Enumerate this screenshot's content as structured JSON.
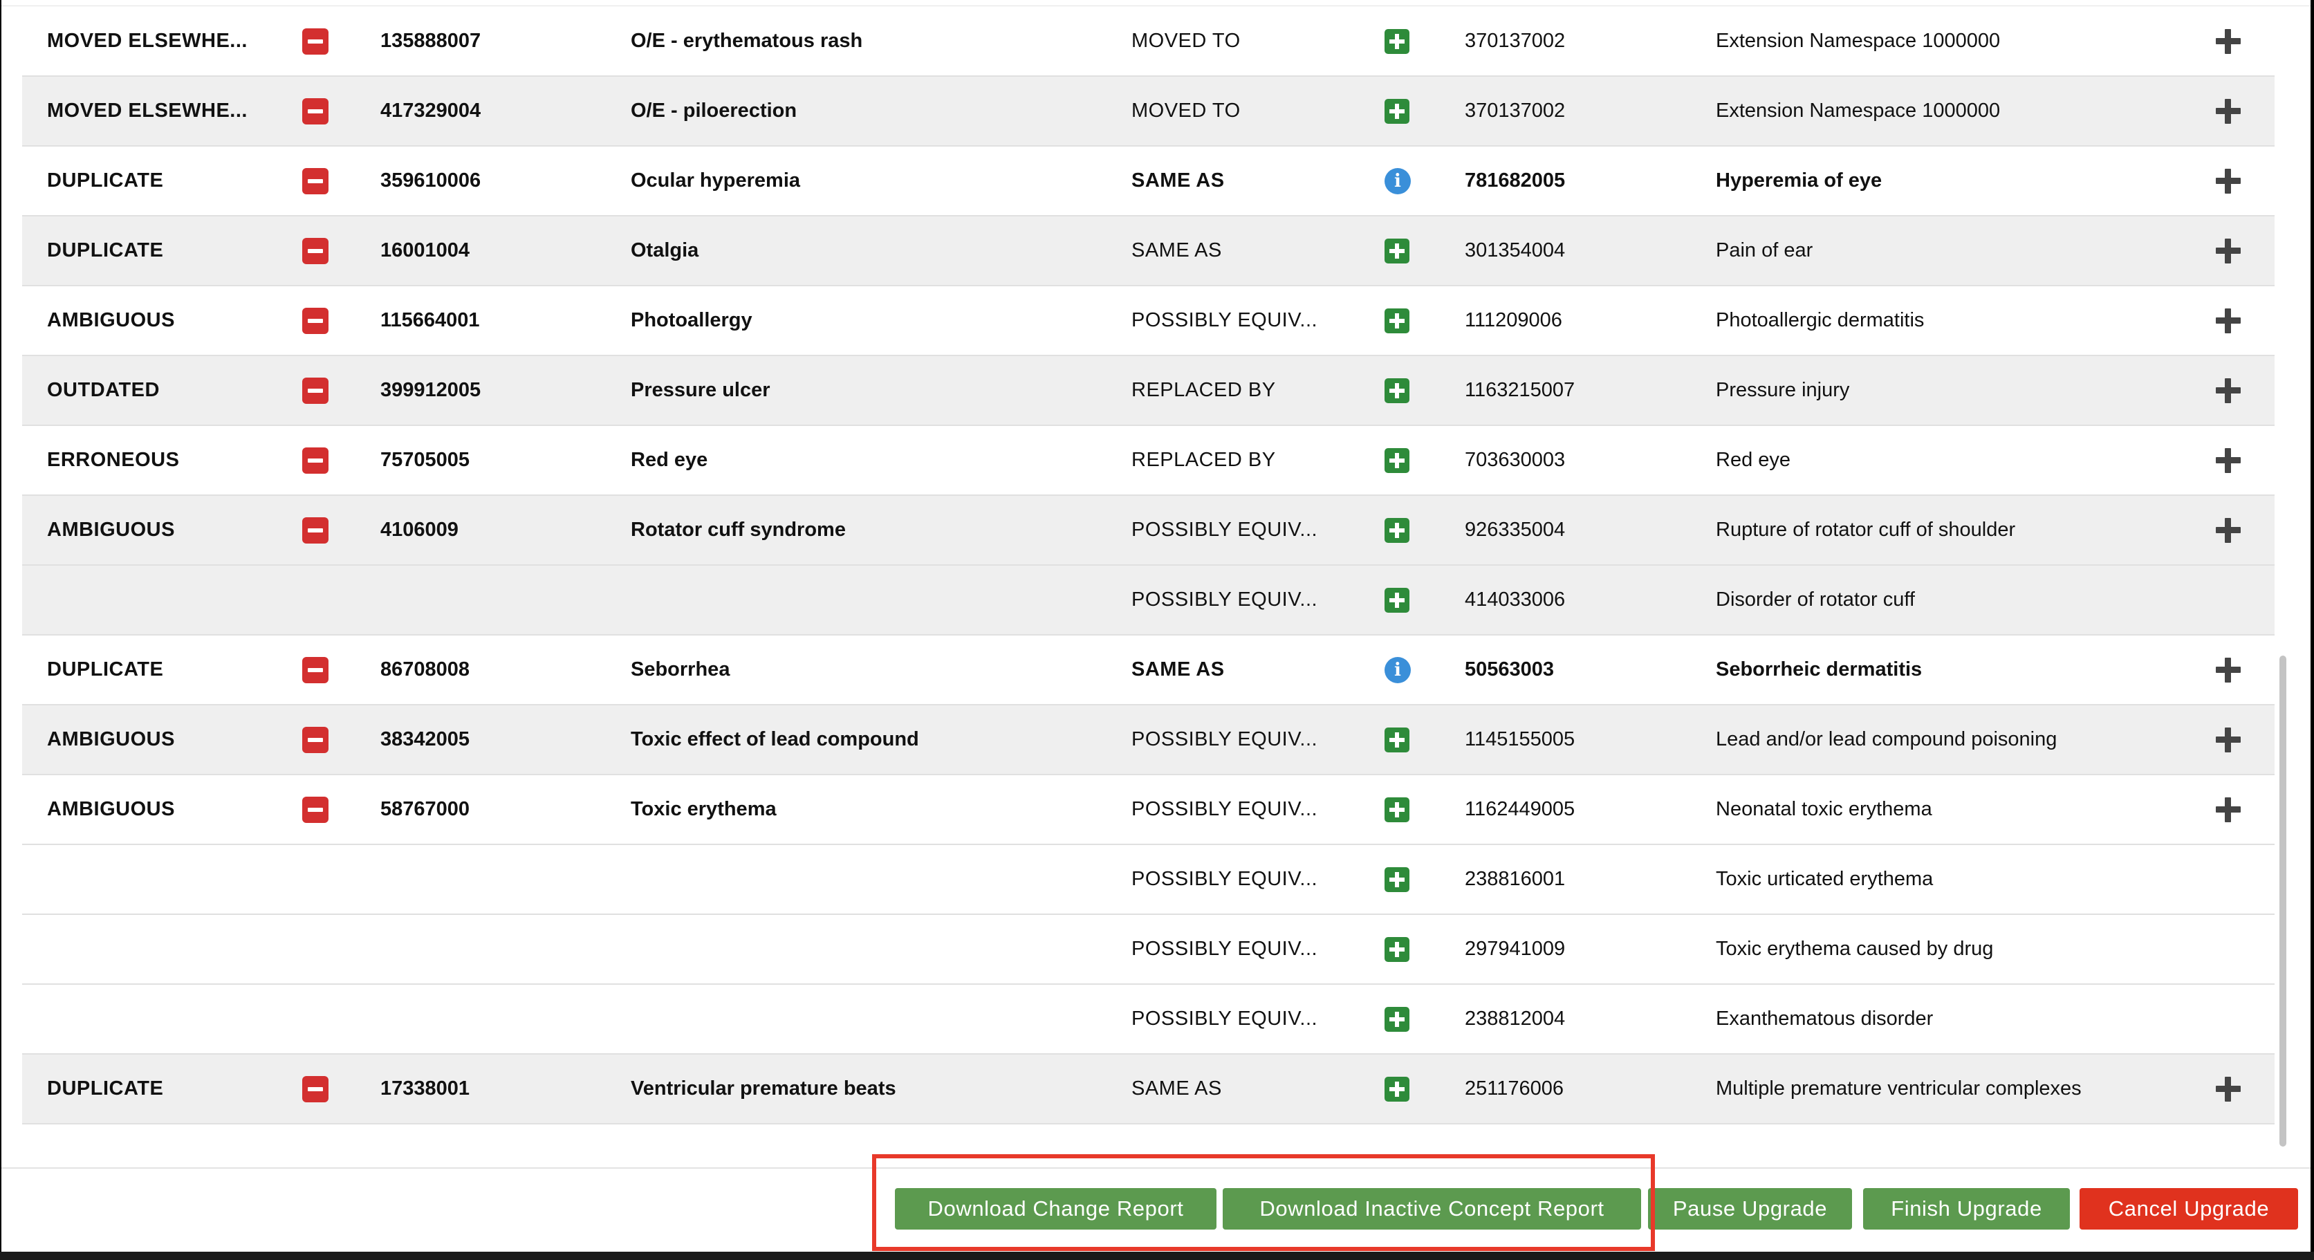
{
  "colors": {
    "delete_icon": "#d32f2f",
    "add_status_icon": "#2e8b3a",
    "info_icon": "#3a8fd9",
    "green_button": "#5c9a4f",
    "red_button": "#e0321e",
    "highlight_border": "#e8392a",
    "row_shaded": "#efefef"
  },
  "icons": {
    "remove": "minus-square-icon",
    "added": "plus-square-icon",
    "info": "info-circle-icon",
    "add_row": "plus-icon"
  },
  "rows": [
    {
      "reason": "MOVED ELSEWHE...",
      "old_id": "135888007",
      "old_name": "O/E - erythematous rash",
      "association": "MOVED TO",
      "status_icon": "plus",
      "new_id": "370137002",
      "new_name": "Extension Namespace 1000000",
      "bold_new": false,
      "shaded": false
    },
    {
      "reason": "MOVED ELSEWHE...",
      "old_id": "417329004",
      "old_name": "O/E - piloerection",
      "association": "MOVED TO",
      "status_icon": "plus",
      "new_id": "370137002",
      "new_name": "Extension Namespace 1000000",
      "bold_new": false,
      "shaded": true
    },
    {
      "reason": "DUPLICATE",
      "old_id": "359610006",
      "old_name": "Ocular hyperemia",
      "association": "SAME AS",
      "status_icon": "info",
      "new_id": "781682005",
      "new_name": "Hyperemia of eye",
      "bold_new": true,
      "shaded": false
    },
    {
      "reason": "DUPLICATE",
      "old_id": "16001004",
      "old_name": "Otalgia",
      "association": "SAME AS",
      "status_icon": "plus",
      "new_id": "301354004",
      "new_name": "Pain of ear",
      "bold_new": false,
      "shaded": true
    },
    {
      "reason": "AMBIGUOUS",
      "old_id": "115664001",
      "old_name": "Photoallergy",
      "association": "POSSIBLY EQUIV...",
      "status_icon": "plus",
      "new_id": "111209006",
      "new_name": "Photoallergic dermatitis",
      "bold_new": false,
      "shaded": false
    },
    {
      "reason": "OUTDATED",
      "old_id": "399912005",
      "old_name": "Pressure ulcer",
      "association": "REPLACED BY",
      "status_icon": "plus",
      "new_id": "1163215007",
      "new_name": "Pressure injury",
      "bold_new": false,
      "shaded": true
    },
    {
      "reason": "ERRONEOUS",
      "old_id": "75705005",
      "old_name": "Red eye",
      "association": "REPLACED BY",
      "status_icon": "plus",
      "new_id": "703630003",
      "new_name": "Red eye",
      "bold_new": false,
      "shaded": false
    },
    {
      "reason": "AMBIGUOUS",
      "old_id": "4106009",
      "old_name": "Rotator cuff syndrome",
      "association": "POSSIBLY EQUIV...",
      "status_icon": "plus",
      "new_id": "926335004",
      "new_name": "Rupture of rotator cuff of shoulder",
      "bold_new": false,
      "shaded": true
    },
    {
      "reason": "",
      "old_id": "",
      "old_name": "",
      "association": "POSSIBLY EQUIV...",
      "status_icon": "plus",
      "new_id": "414033006",
      "new_name": "Disorder of rotator cuff",
      "bold_new": false,
      "shaded": true,
      "continuation": true
    },
    {
      "reason": "DUPLICATE",
      "old_id": "86708008",
      "old_name": "Seborrhea",
      "association": "SAME AS",
      "status_icon": "info",
      "new_id": "50563003",
      "new_name": "Seborrheic dermatitis",
      "bold_new": true,
      "shaded": false
    },
    {
      "reason": "AMBIGUOUS",
      "old_id": "38342005",
      "old_name": "Toxic effect of lead compound",
      "association": "POSSIBLY EQUIV...",
      "status_icon": "plus",
      "new_id": "1145155005",
      "new_name": "Lead and/or lead compound poisoning",
      "bold_new": false,
      "shaded": true
    },
    {
      "reason": "AMBIGUOUS",
      "old_id": "58767000",
      "old_name": "Toxic erythema",
      "association": "POSSIBLY EQUIV...",
      "status_icon": "plus",
      "new_id": "1162449005",
      "new_name": "Neonatal toxic erythema",
      "bold_new": false,
      "shaded": false
    },
    {
      "reason": "",
      "old_id": "",
      "old_name": "",
      "association": "POSSIBLY EQUIV...",
      "status_icon": "plus",
      "new_id": "238816001",
      "new_name": "Toxic urticated erythema",
      "bold_new": false,
      "shaded": false,
      "continuation": true
    },
    {
      "reason": "",
      "old_id": "",
      "old_name": "",
      "association": "POSSIBLY EQUIV...",
      "status_icon": "plus",
      "new_id": "297941009",
      "new_name": "Toxic erythema caused by drug",
      "bold_new": false,
      "shaded": false,
      "continuation": true
    },
    {
      "reason": "",
      "old_id": "",
      "old_name": "",
      "association": "POSSIBLY EQUIV...",
      "status_icon": "plus",
      "new_id": "238812004",
      "new_name": "Exanthematous disorder",
      "bold_new": false,
      "shaded": false,
      "continuation": true
    },
    {
      "reason": "DUPLICATE",
      "old_id": "17338001",
      "old_name": "Ventricular premature beats",
      "association": "SAME AS",
      "status_icon": "plus",
      "new_id": "251176006",
      "new_name": "Multiple premature ventricular complexes",
      "bold_new": false,
      "shaded": true
    }
  ],
  "footer": {
    "download_change_report": "Download Change Report",
    "download_inactive_concept_report": "Download Inactive Concept Report",
    "pause_upgrade": "Pause Upgrade",
    "finish_upgrade": "Finish Upgrade",
    "cancel_upgrade": "Cancel Upgrade"
  }
}
